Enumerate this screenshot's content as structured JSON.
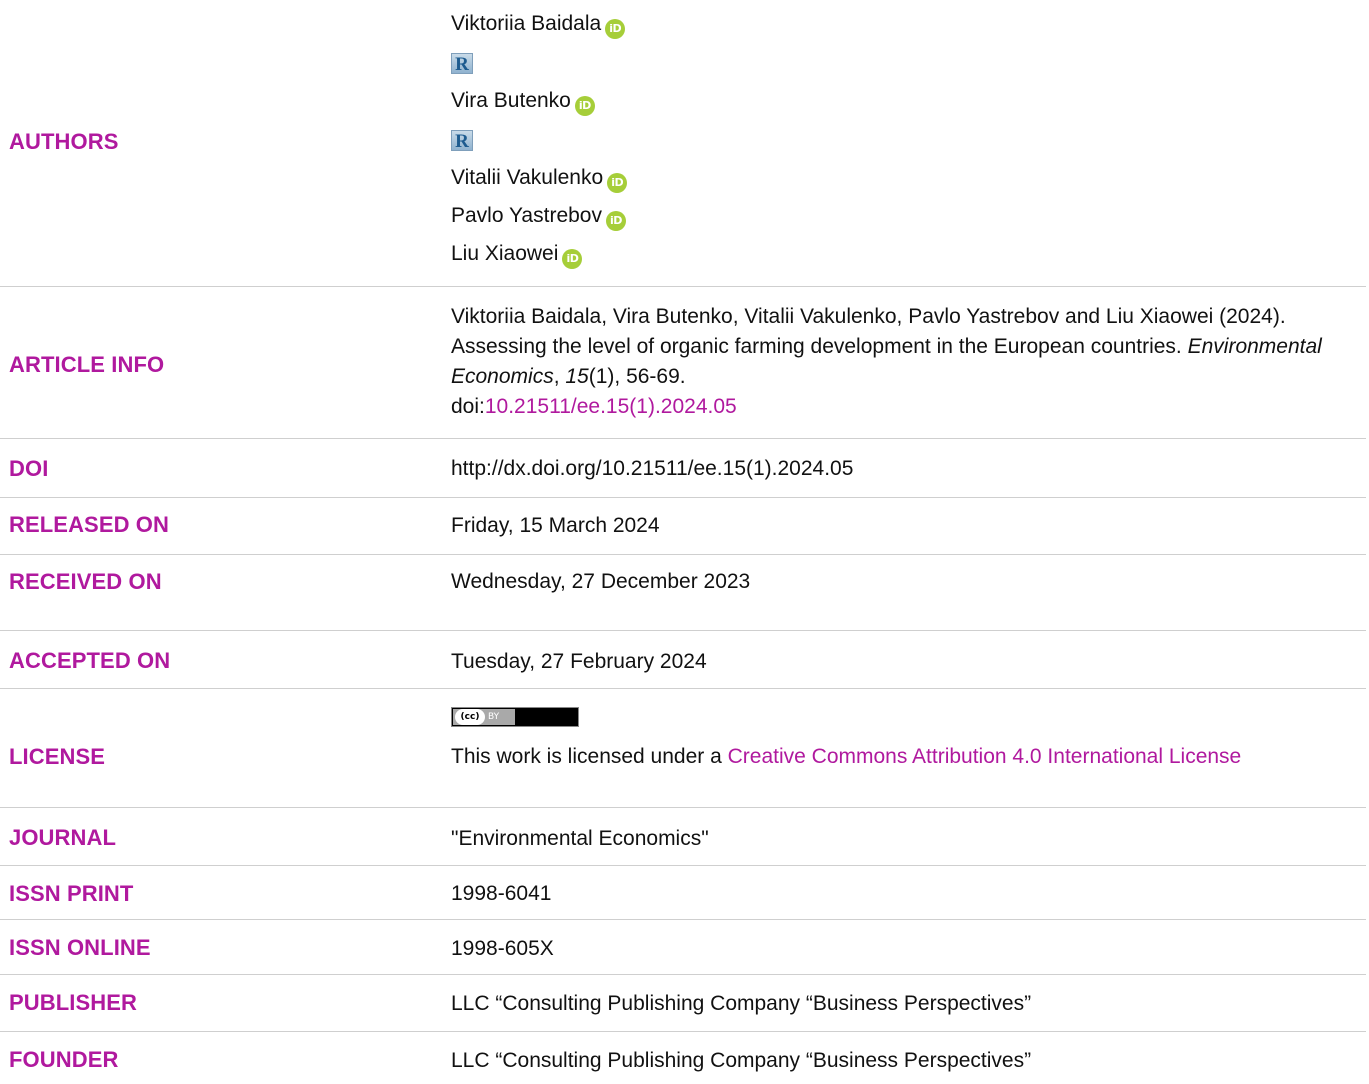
{
  "authors": {
    "label": "AUTHORS",
    "list": [
      {
        "name": "Viktoriia Baidala",
        "orcid_icon": "iD"
      },
      {
        "name": "Vira Butenko",
        "orcid_icon": "iD"
      },
      {
        "name": "Vitalii Vakulenko",
        "orcid_icon": "iD"
      },
      {
        "name": "Pavlo Yastrebov",
        "orcid_icon": "iD"
      },
      {
        "name": "Liu Xiaowei",
        "orcid_icon": "iD"
      }
    ],
    "researcherid_icon": "R"
  },
  "article_info": {
    "label": "ARTICLE INFO",
    "citation_authors": "Viktoriia Baidala, Vira Butenko, Vitalii Vakulenko, Pavlo Yastrebov and Liu Xiaowei (2024). Assessing the level of organic farming development in the European countries. ",
    "journal_italic": "Environmental Economics",
    "sep": ", ",
    "volume_italic": "15",
    "issue_pages": "(1), 56-69.",
    "doi_prefix": "doi:",
    "doi_link": "10.21511/ee.15(1).2024.05"
  },
  "doi": {
    "label": "DOI",
    "value": "http://dx.doi.org/10.21511/ee.15(1).2024.05"
  },
  "released": {
    "label": "RELEASED ON",
    "value": "Friday, 15 March 2024"
  },
  "received": {
    "label": "RECEIVED ON",
    "value": "Wednesday, 27 December 2023"
  },
  "accepted": {
    "label": "ACCEPTED ON",
    "value": "Tuesday, 27 February 2024"
  },
  "license": {
    "label": "LICENSE",
    "badge_cc": "(cc)",
    "badge_by": "BY",
    "text": "This work is licensed under a ",
    "link": "Creative Commons Attribution 4.0 International License"
  },
  "journal": {
    "label": "JOURNAL",
    "value": "\"Environmental Economics\""
  },
  "issn_print": {
    "label": "ISSN PRINT",
    "value": "1998-6041"
  },
  "issn_online": {
    "label": "ISSN ONLINE",
    "value": "1998-605X"
  },
  "publisher": {
    "label": "PUBLISHER",
    "value": "LLC “Consulting Publishing Company “Business Perspectives”"
  },
  "founder": {
    "label": "FOUNDER",
    "value": "LLC “Consulting Publishing Company “Business Perspectives”"
  },
  "colors": {
    "accent": "#b0199e",
    "orcid": "#a6ce39",
    "divider": "#cfcfcf"
  }
}
